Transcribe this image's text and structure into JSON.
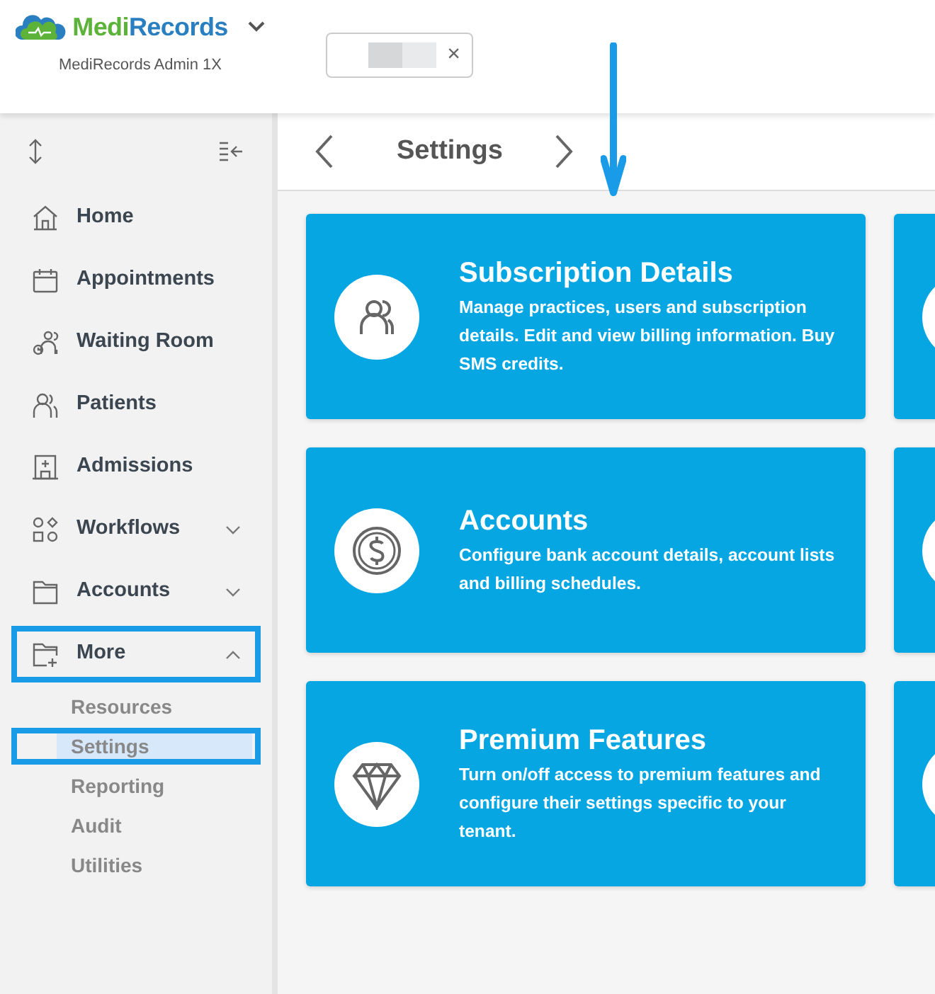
{
  "app": {
    "brand_part_1": "Medi",
    "brand_part_2": "Records",
    "subtitle": "MediRecords Admin 1X",
    "tab": {
      "redacted": true,
      "close": "×"
    }
  },
  "sidebar": {
    "items": [
      {
        "label": "Home",
        "kind": "home",
        "highlighted": false
      },
      {
        "label": "Appointments",
        "kind": "calendar",
        "highlighted": false
      },
      {
        "label": "Waiting Room",
        "kind": "waiting",
        "highlighted": false
      },
      {
        "label": "Patients",
        "kind": "people",
        "highlighted": false
      },
      {
        "label": "Admissions",
        "kind": "hospital",
        "highlighted": false
      },
      {
        "label": "Workflows",
        "kind": "workflow",
        "expanded": false,
        "highlighted": false
      },
      {
        "label": "Accounts",
        "kind": "folder",
        "expanded": false,
        "highlighted": false
      },
      {
        "label": "More",
        "kind": "folderplus",
        "expanded": true,
        "highlighted": true,
        "children": [
          {
            "label": "Resources",
            "selected": false,
            "highlighted": false
          },
          {
            "label": "Settings",
            "selected": true,
            "highlighted": true
          },
          {
            "label": "Reporting",
            "selected": false,
            "highlighted": false
          },
          {
            "label": "Audit",
            "selected": false,
            "highlighted": false
          },
          {
            "label": "Utilities",
            "selected": false,
            "highlighted": false
          }
        ]
      }
    ]
  },
  "page": {
    "title": "Settings"
  },
  "cards": [
    {
      "kind": "people",
      "title": "Subscription Details",
      "description": "Manage practices, users and subscription details. Edit and view billing information. Buy SMS credits."
    },
    {
      "kind": "dollar",
      "title": "Accounts",
      "description": "Configure bank account details, account lists and billing schedules."
    },
    {
      "kind": "diamond",
      "title": "Premium Features",
      "description": "Turn on/off access to premium features and configure their settings specific to your tenant."
    }
  ],
  "cut_off_cards": [
    {
      "kind": "card"
    },
    {
      "kind": "card"
    },
    {
      "kind": "card"
    }
  ],
  "annotations": [
    {
      "kind": "arrow"
    }
  ]
}
